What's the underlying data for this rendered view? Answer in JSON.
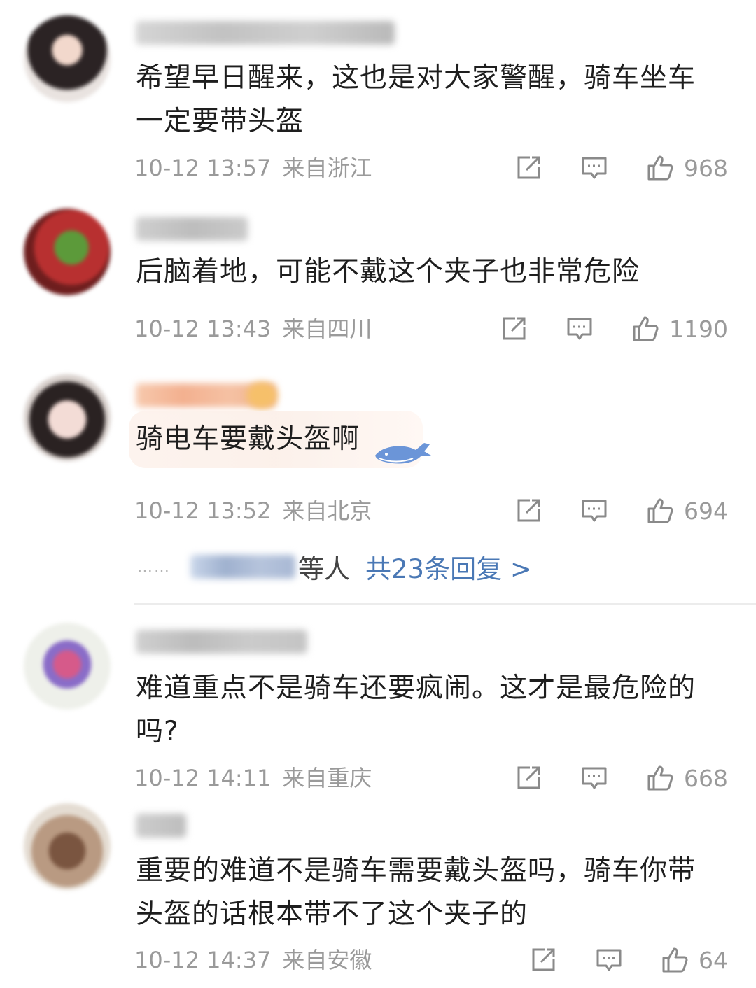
{
  "comments": [
    {
      "text": "希望早日醒来，这也是对大家警醒，骑车坐车一定要带头盔",
      "time": "10-12 13:57",
      "location": "来自浙江",
      "likes": "968"
    },
    {
      "text": "后脑着地，可能不戴这个夹子也非常危险",
      "time": "10-12 13:43",
      "location": "来自四川",
      "likes": "1190"
    },
    {
      "text": "骑电车要戴头盔啊",
      "time": "10-12 13:52",
      "location": "来自北京",
      "likes": "694",
      "replies": {
        "dots": "……",
        "suffix": "等人",
        "link": "共23条回复 >"
      }
    },
    {
      "text": "难道重点不是骑车还要疯闹。这才是最危险的吗?",
      "time": "10-12 14:11",
      "location": "来自重庆",
      "likes": "668"
    },
    {
      "text": "重要的难道不是骑车需要戴头盔吗，骑车你带头盔的话根本带不了这个夹子的",
      "time": "10-12 14:37",
      "location": "来自安徽",
      "likes": "64"
    }
  ],
  "icons": {
    "share": "share-icon",
    "comment": "comment-icon",
    "like": "thumbs-up-icon",
    "bubble_decoration": "whale-icon"
  },
  "colors": {
    "text": "#1e1e1e",
    "meta": "#9a9a9a",
    "link": "#4a78b5"
  }
}
